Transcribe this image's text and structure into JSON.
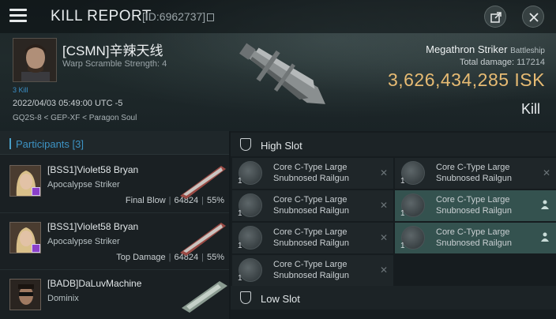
{
  "header": {
    "title": "KILL REPORT",
    "report_id": "[ID:6962737]"
  },
  "victim": {
    "name": "[CSMN]辛辣天线",
    "warp_scramble": "Warp Scramble Strength: 4",
    "level": "3 Kill",
    "datetime": "2022/04/03 05:49:00 UTC -5",
    "location": "GQ2S-8 < GEP-XF < Paragon Soul"
  },
  "ship": {
    "name": "Megathron Striker",
    "class": "Battleship",
    "total_damage_label": "Total damage:",
    "total_damage": "117214",
    "isk_value": "3,626,434,285",
    "isk_unit": "ISK",
    "result": "Kill"
  },
  "participants": {
    "label": "Participants",
    "count": "[3]",
    "items": [
      {
        "name": "[BSS1]Violet58 Bryan",
        "ship": "Apocalypse Striker",
        "tag": "Final Blow",
        "damage": "64824",
        "percent": "55%"
      },
      {
        "name": "[BSS1]Violet58 Bryan",
        "ship": "Apocalypse Striker",
        "tag": "Top Damage",
        "damage": "64824",
        "percent": "55%"
      },
      {
        "name": "[BADB]DaLuvMachine",
        "ship": "Dominix",
        "tag": "",
        "damage": "",
        "percent": ""
      }
    ]
  },
  "fitting": {
    "high_slot_label": "High Slot",
    "low_slot_label": "Low Slot",
    "high_slot": [
      {
        "qty": "1",
        "name": "Core C-Type Large Snubnosed Railgun",
        "state": "destroyed"
      },
      {
        "qty": "1",
        "name": "Core C-Type Large Snubnosed Railgun",
        "state": "destroyed"
      },
      {
        "qty": "1",
        "name": "Core C-Type Large Snubnosed Railgun",
        "state": "destroyed"
      },
      {
        "qty": "1",
        "name": "Core C-Type Large Snubnosed Railgun",
        "state": "destroyed"
      },
      {
        "qty": "1",
        "name": "Core C-Type Large Snubnosed Railgun",
        "state": "dropped"
      },
      {
        "qty": "1",
        "name": "Core C-Type Large Snubnosed Railgun",
        "state": "destroyed"
      },
      {
        "qty": "1",
        "name": "Core C-Type Large Snubnosed Railgun",
        "state": "dropped"
      }
    ]
  },
  "colors": {
    "isk": "#e7bb73",
    "accent": "#3d93c4",
    "dropped_bg": "#34524f",
    "badge": "#8a3fc9"
  }
}
